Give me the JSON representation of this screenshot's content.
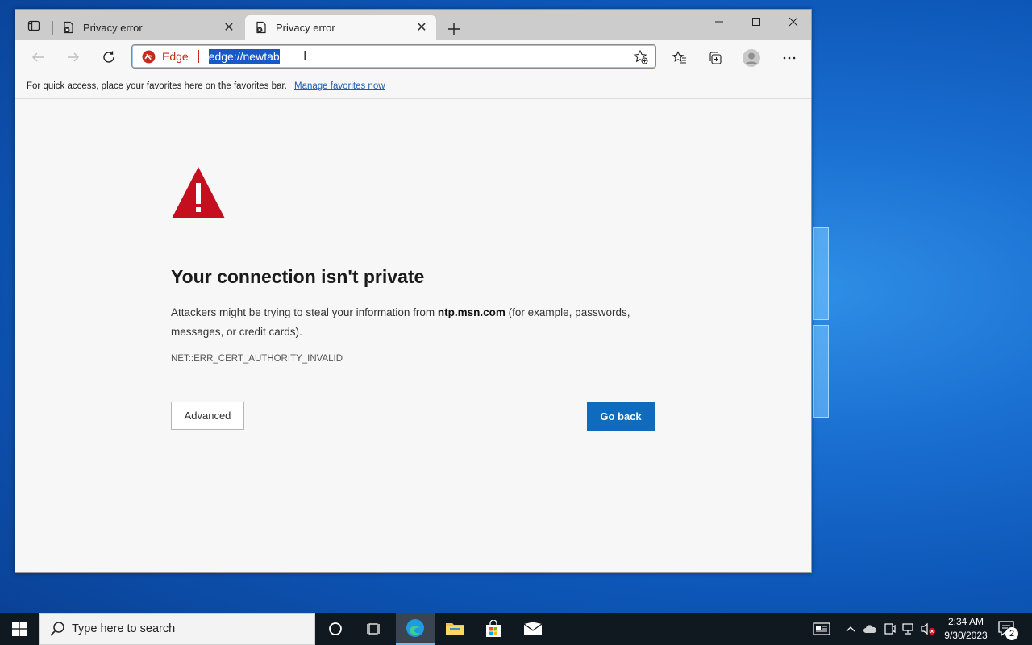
{
  "browser": {
    "tabs": [
      {
        "title": "Privacy error",
        "active": false
      },
      {
        "title": "Privacy error",
        "active": true
      }
    ],
    "address_bar": {
      "site_label": "Edge",
      "url": "edge://newtab"
    },
    "favorites_bar": {
      "message": "For quick access, place your favorites here on the favorites bar.",
      "link_label": "Manage favorites now"
    }
  },
  "error_page": {
    "title": "Your connection isn't private",
    "description_prefix": "Attackers might be trying to steal your information from ",
    "host": "ntp.msn.com",
    "description_suffix": " (for example, passwords, messages, or credit cards).",
    "error_code": "NET::ERR_CERT_AUTHORITY_INVALID",
    "advanced_label": "Advanced",
    "go_back_label": "Go back",
    "accent_color": "#0f6cbd",
    "warning_color": "#c50f1f"
  },
  "taskbar": {
    "search_placeholder": "Type here to search",
    "time": "2:34 AM",
    "date": "9/30/2023",
    "notification_count": "2"
  }
}
